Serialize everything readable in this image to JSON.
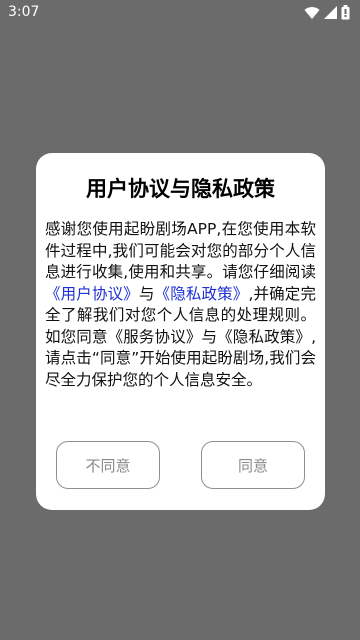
{
  "status_bar": {
    "time": "3:07",
    "icons": [
      "wifi-icon",
      "signal-icon",
      "battery-icon"
    ]
  },
  "dialog": {
    "title": "用户协议与隐私政策",
    "body": {
      "part1": "感谢您使用起盼剧场APP,在您使用本软件过程中,我们可能会对您的部分个人信息进行收集,使用和共享。请您仔细阅读",
      "link_user_agreement": "《用户协议》",
      "part2": "与",
      "link_privacy_policy": "《隐私政策》",
      "part3": ",并确定完全了解我们对您个人信息的处理规则。如您同意《服务协议》与《隐私政策》,请点击“同意”开始使用起盼剧场,我们会尽全力保护您的个人信息安全。"
    },
    "buttons": {
      "disagree": "不同意",
      "agree": "同意"
    }
  },
  "colors": {
    "overlay": "#6b6b6b",
    "link": "#1e2fd4",
    "button_text": "#8a8a8a"
  }
}
